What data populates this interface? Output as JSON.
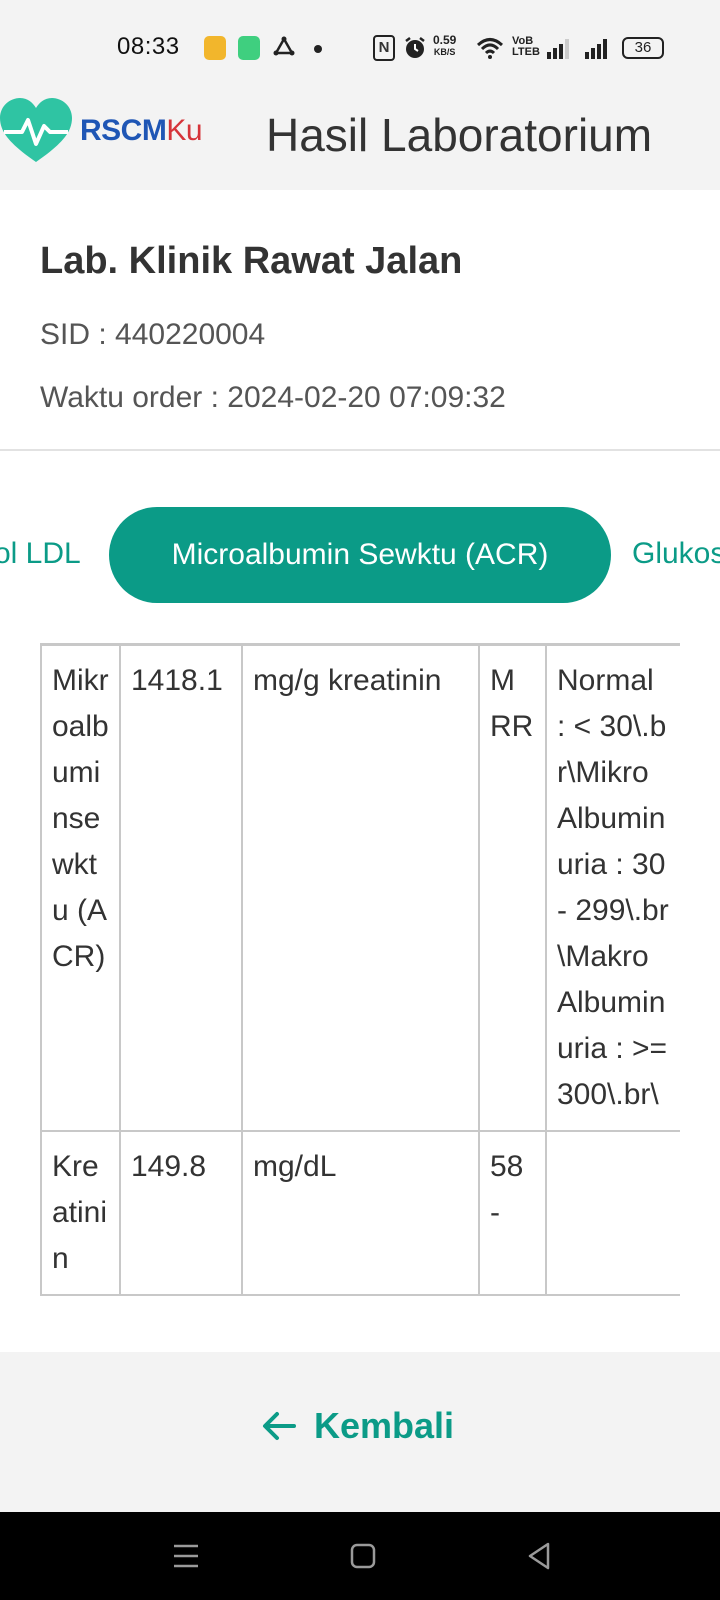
{
  "status_bar": {
    "time": "08:33",
    "network_speed_value": "0.59",
    "network_speed_unit": "KB/S",
    "volte_line1": "VoB",
    "volte_line2": "LTEB",
    "battery": "36",
    "icons": [
      "app-notification-icon",
      "app-notification-icon",
      "sync-icon",
      "nfc-icon",
      "alarm-icon",
      "wifi-icon",
      "signal-icon",
      "signal-icon",
      "battery-icon"
    ]
  },
  "header": {
    "logo_main": "RSCM",
    "logo_suffix": "Ku",
    "title": "Hasil Laboratorium"
  },
  "lab": {
    "name": "Lab. Klinik Rawat Jalan",
    "sid": "SID : 440220004",
    "order_time": "Waktu order : 2024-02-20 07:09:32"
  },
  "tabs": {
    "left": "ol LDL",
    "active": "Microalbumin Sewktu (ACR)",
    "right": "Glukos"
  },
  "table": {
    "rows": [
      {
        "test": "Mikroalbuminsewktu (ACR)",
        "value": "1418.1",
        "unit": "mg/g kreatinin",
        "flag": "MRR",
        "reference": "Normal : < 30\\.br\\Mikro Albuminuria : 30 - 299\\.br\\Makro Albuminuria : >= 300\\.br\\"
      },
      {
        "test": "Kreatinin",
        "value": "149.8",
        "unit": "mg/dL",
        "flag": "58 -",
        "reference": ""
      }
    ]
  },
  "footer": {
    "back_label": "Kembali"
  },
  "colors": {
    "accent": "#0b9b87",
    "logo_blue": "#1f56b5",
    "logo_red": "#d6343a"
  }
}
